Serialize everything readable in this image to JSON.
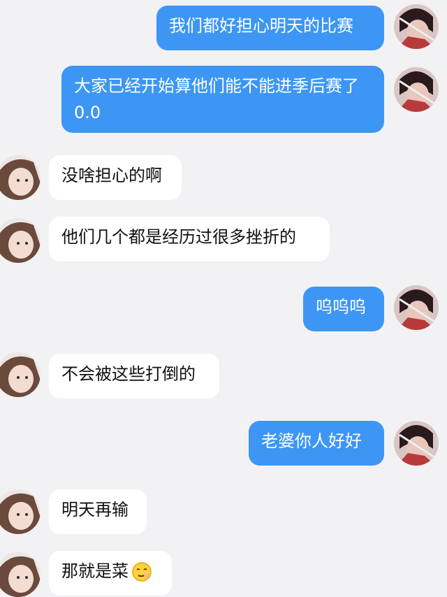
{
  "colors": {
    "me_bubble": "#3d96f4",
    "other_bubble": "#ffffff",
    "background": "#f2f2f4"
  },
  "messages": [
    {
      "sender": "me",
      "text": "我们都好担心明天的比赛"
    },
    {
      "sender": "me",
      "text": "大家已经开始算他们能不能进季后赛了 0.0"
    },
    {
      "sender": "other",
      "text": "没啥担心的啊"
    },
    {
      "sender": "other",
      "text": "他们几个都是经历过很多挫折的"
    },
    {
      "sender": "me",
      "text": "呜呜呜"
    },
    {
      "sender": "other",
      "text": "不会被这些打倒的"
    },
    {
      "sender": "me",
      "text": "老婆你人好好"
    },
    {
      "sender": "other",
      "text": "明天再输"
    },
    {
      "sender": "other",
      "text": "那就是菜",
      "emoji": "smirking-face-emoji"
    }
  ]
}
